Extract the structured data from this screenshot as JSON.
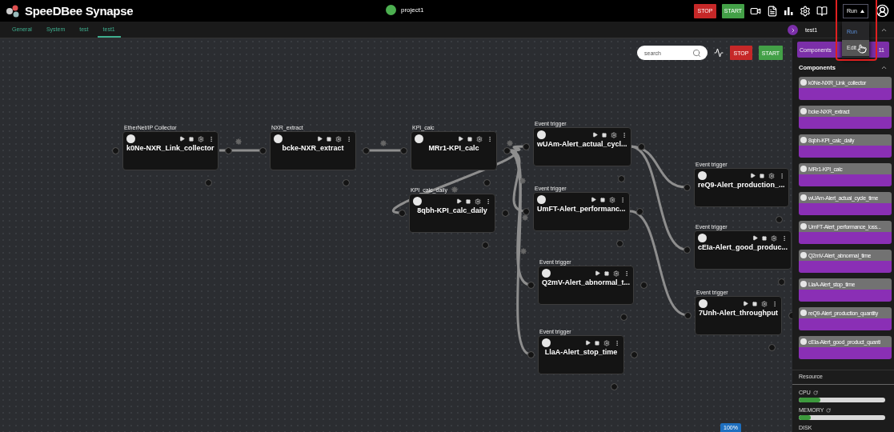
{
  "header": {
    "logo": "SpeeDBee Synapse",
    "project": {
      "name": "project1"
    },
    "buttons": [
      "STOP",
      "START"
    ],
    "run_menu": {
      "label": "Run",
      "expanded": true,
      "options": [
        {
          "label": "Run",
          "selected": true
        },
        {
          "label": "Edit",
          "selected": false
        }
      ]
    }
  },
  "tabs": [
    {
      "label": "General",
      "selected": false
    },
    {
      "label": "System",
      "selected": false
    },
    {
      "label": "test",
      "selected": false
    },
    {
      "label": "test1",
      "selected": true
    }
  ],
  "canvas": {
    "search": {
      "placeholder": "search"
    },
    "buttons": [
      "STOP",
      "START"
    ],
    "zoom": "100%",
    "nodes": [
      {
        "type_label": "EtherNet/IP Collector",
        "name": "k0Ne-NXR_Link_collector"
      },
      {
        "type_label": "NXR_extract",
        "name": "bcke-NXR_extract"
      },
      {
        "type_label": "KPI_calc",
        "name": "MRr1-KPI_calc"
      },
      {
        "type_label": "KPI_calc_daily",
        "name": "8qbh-KPI_calc_daily"
      },
      {
        "type_label": "Event trigger",
        "name": "wUAm-Alert_actual_cycl..."
      },
      {
        "type_label": "Event trigger",
        "name": "UmFT-Alert_performanc..."
      },
      {
        "type_label": "Event trigger",
        "name": "reQ9-Alert_production_..."
      },
      {
        "type_label": "Event trigger",
        "name": "cEIa-Alert_good_produc..."
      },
      {
        "type_label": "Event trigger",
        "name": "Q2mV-Alert_abnormal_t..."
      },
      {
        "type_label": "Event trigger",
        "name": "7Unh-Alert_throughput"
      },
      {
        "type_label": "Event trigger",
        "name": "LlaA-Alert_stop_time"
      }
    ]
  },
  "sidebar": {
    "title": "test1",
    "tab": {
      "label": "Components",
      "count": "11"
    },
    "section": "Components",
    "components": [
      "k0Ne-NXR_Link_collector",
      "bcke-NXR_extract",
      "8qbh-KPI_calc_daily",
      "MRr1-KPI_calc",
      "wUAm-Alert_actual_cycle_time",
      "UmFT-Alert_performance_loss...",
      "Q2mV-Alert_abnormal_time",
      "LlaA-Alert_stop_time",
      "reQ9-Alert_production_quantity",
      "cEIa-Alert_good_product_quanti"
    ],
    "resource": {
      "title": "Resource",
      "meters": [
        {
          "label": "CPU",
          "level": 0.25
        },
        {
          "label": "MEMORY",
          "level": 0.14
        }
      ],
      "disk": "DISK"
    }
  }
}
